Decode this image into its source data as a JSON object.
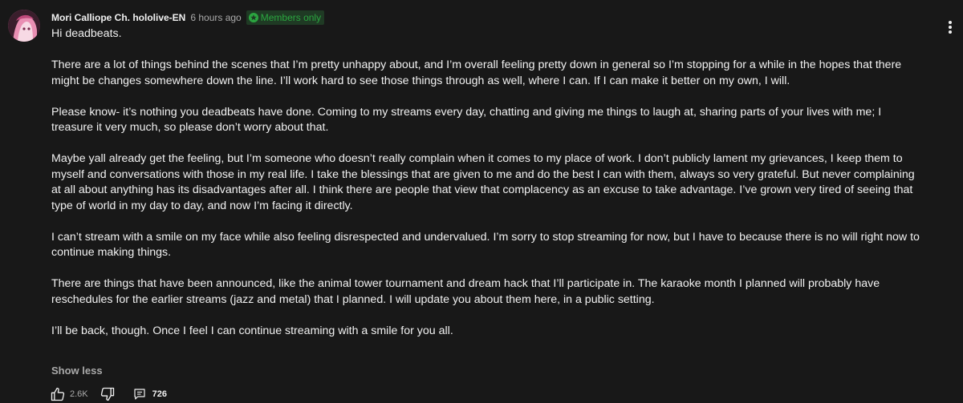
{
  "post": {
    "author": "Mori Calliope Ch. hololive-EN",
    "time": "6 hours ago",
    "badge": "Members only",
    "paragraphs": [
      "Hi deadbeats.",
      "There are a lot of things behind the scenes that I’m pretty unhappy about, and I’m overall feeling pretty down in general so I’m stopping for a while in the hopes that there might be changes somewhere down the line. I’ll work hard to see those things through as well, where I can. If I can make it better on my own, I will.",
      "Please know- it’s nothing you deadbeats have done. Coming to my streams every day, chatting and giving me things to laugh at, sharing parts of your lives with me; I treasure it very much, so please don’t worry about that.",
      "Maybe yall already get the feeling, but I’m someone who doesn’t really complain when it comes to my place of work. I don’t publicly lament my grievances, I keep them to myself and conversations with those in my real life. I take the blessings that are given to me and do the best I can with them, always so very grateful. But never complaining at all about anything has its disadvantages after all. I think there are people that view that complacency as an excuse to take advantage. I’ve grown very tired of seeing that type of world in my day to day, and now I’m facing it directly.",
      "I can’t stream with a smile on my face while also feeling disrespected and undervalued. I’m sorry to stop streaming for now, but I have to because there is no will right now to continue making things.",
      "There are things that have been announced, like the animal tower tournament and dream hack that I’ll participate in. The karaoke month I planned will probably have reschedules for the earlier streams (jazz and metal) that I planned. I will update you about them here, in a public setting.",
      "I’ll be back, though. Once I feel I can continue streaming with a smile for you all."
    ],
    "show_less": "Show less",
    "likes": "2.6K",
    "comments": "726"
  },
  "colors": {
    "background": "#181818",
    "text": "#f1f1f1",
    "secondary": "#aaaaaa",
    "members_green": "#2ba640"
  },
  "icons": {
    "avatar": "channel-avatar",
    "badge": "members-star-icon",
    "like": "thumbs-up-icon",
    "dislike": "thumbs-down-icon",
    "comment": "comment-icon",
    "menu": "more-vert-icon"
  }
}
